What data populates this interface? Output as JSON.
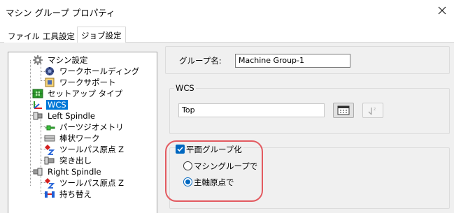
{
  "window": {
    "title": "マシン グループ プロパティ"
  },
  "tabs": [
    {
      "label": "ファイル",
      "selected": false
    },
    {
      "label": "工具設定",
      "selected": false
    },
    {
      "label": "ジョブ設定",
      "selected": true
    }
  ],
  "tree": {
    "items": [
      {
        "label": "マシン設定",
        "icon": "gear-icon"
      },
      {
        "label": "ワークホールディング",
        "icon": "workholding-icon"
      },
      {
        "label": "ワークサポート",
        "icon": "worksupport-icon"
      },
      {
        "label": "セットアップ タイプ",
        "icon": "setup-type-icon"
      },
      {
        "label": "WCS",
        "icon": "wcs-axis-icon",
        "selected": true
      },
      {
        "label": "Left Spindle",
        "icon": "spindle-icon"
      },
      {
        "label": "パーツジオメトリ",
        "icon": "part-geometry-icon"
      },
      {
        "label": "棒状ワーク",
        "icon": "bar-stock-icon"
      },
      {
        "label": "ツールパス原点 Z",
        "icon": "toolpath-origin-icon"
      },
      {
        "label": "突き出し",
        "icon": "stickout-icon"
      },
      {
        "label": "Right Spindle",
        "icon": "spindle-icon"
      },
      {
        "label": "ツールパス原点 Z",
        "icon": "toolpath-origin-icon"
      },
      {
        "label": "持ち替え",
        "icon": "transfer-icon"
      }
    ]
  },
  "group_name": {
    "label": "グループ名:",
    "value": "Machine Group-1"
  },
  "wcs": {
    "title": "WCS",
    "value": "Top"
  },
  "plane_group": {
    "checkbox_label": "平面グループ化",
    "checked": true,
    "options": [
      {
        "label": "マシングループで",
        "selected": false
      },
      {
        "label": "主軸原点で",
        "selected": true
      }
    ]
  },
  "colors": {
    "accent": "#0078d7",
    "highlight": "#e35a60"
  }
}
